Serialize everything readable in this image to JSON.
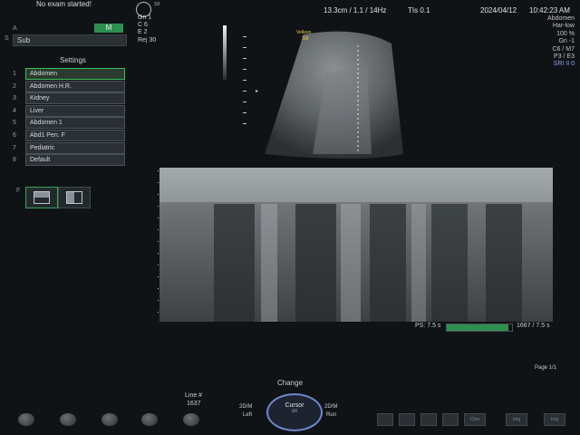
{
  "header": {
    "status": "No exam started!",
    "depth_freq": "13.3cm / 1.1 / 14Hz",
    "tis": "TIs  0.1",
    "date": "2024/04/12",
    "time": "10:42:23 AM"
  },
  "left_panel": {
    "label_a": "A",
    "label_s": "S",
    "sub_label": "Sub",
    "mode_badge": "M",
    "settings_title": "Settings",
    "presets": [
      {
        "num": "1",
        "name": "Abdomen"
      },
      {
        "num": "2",
        "name": "Abdomen H.R."
      },
      {
        "num": "3",
        "name": "Kidney"
      },
      {
        "num": "4",
        "name": "Liver"
      },
      {
        "num": "5",
        "name": "Abdomen 1"
      },
      {
        "num": "6",
        "name": "Abd1 Pen. F"
      },
      {
        "num": "7",
        "name": "Pediatric"
      },
      {
        "num": "8",
        "name": "Default"
      }
    ],
    "f_label": "F"
  },
  "image_params": {
    "gn": "Gn  1",
    "c": "C   6",
    "e": "E   2",
    "rej": "Rej  30",
    "probe_label": "Velleen",
    "probe_sub": "S8",
    "logo_sub": "S8"
  },
  "right_params": [
    "Abdomen",
    "Har-low",
    "100 %",
    "Gn  -1",
    "C6 / M7",
    "P3 / E3",
    "SRI II 0"
  ],
  "mmode": {
    "sweep_left": "PS: 7.5 s",
    "sweep_right": "1667 / 7.5 s"
  },
  "footer": {
    "page": "Page 1/1",
    "change": "Change",
    "line_label": "Line #",
    "line_value": "1637",
    "left_mode": "2D/M",
    "left_sub": "Left",
    "cursor_label": "Cursor",
    "cursor_sub": "on",
    "right_mode": "2D/M",
    "right_sub": "Run",
    "cine_label": "Cine",
    "img_labels": [
      "Img",
      "Img"
    ]
  },
  "colors": {
    "accent": "#3bbf5a",
    "highlight": "#e8c84a",
    "sri": "#8fa3ff"
  }
}
